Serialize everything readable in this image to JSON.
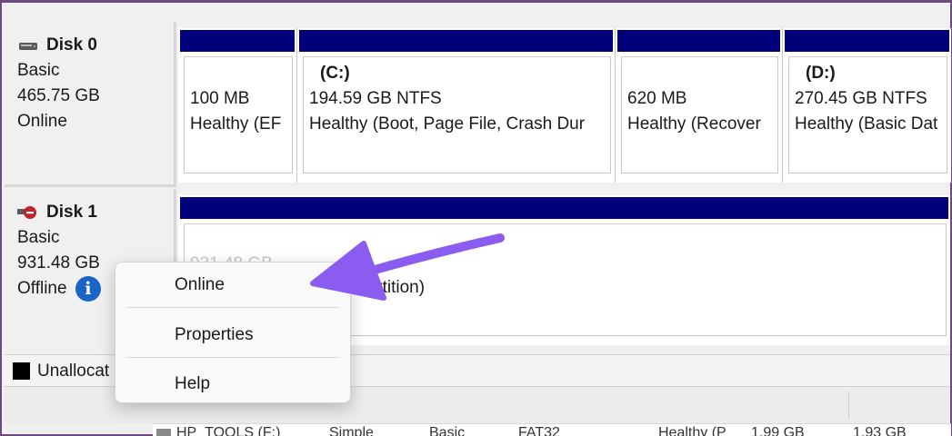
{
  "disks": [
    {
      "name": "Disk 0",
      "type": "Basic",
      "size": "465.75 GB",
      "status": "Online",
      "icon": "disk-drive-icon",
      "partitions": [
        {
          "drive": "",
          "size": "100 MB",
          "status": "Healthy (EF"
        },
        {
          "drive": "(C:)",
          "size": "194.59 GB NTFS",
          "status": "Healthy (Boot, Page File, Crash Dur"
        },
        {
          "drive": "",
          "size": "620 MB",
          "status": "Healthy (Recover"
        },
        {
          "drive": "(D:)",
          "size": "270.45 GB NTFS",
          "status": "Healthy (Basic Dat"
        }
      ]
    },
    {
      "name": "Disk 1",
      "type": "Basic",
      "size": "931.48 GB",
      "status": "Offline",
      "icon": "offline-disk-icon",
      "info_icon": "i",
      "partitions": [
        {
          "drive": "",
          "size": "931.48 GB",
          "status": "Partition)"
        }
      ]
    }
  ],
  "legend": {
    "label": "Unallocated",
    "visible_label": "Unallocat"
  },
  "volume_list_row": {
    "name": "HP_TOOLS (F:)",
    "layout": "Simple",
    "type": "Basic",
    "file_system": "FAT32",
    "status": "Healthy (P",
    "capacity": "1.99 GB",
    "free": "1.93 GB"
  },
  "context_menu": {
    "items": [
      "Online",
      "Properties",
      "Help"
    ]
  },
  "colors": {
    "partition_bar": "#00007a",
    "arrow": "#8a5cf0",
    "frame": "#6b4a84",
    "info": "#1a64c8",
    "offline_badge": "#c0232c"
  }
}
